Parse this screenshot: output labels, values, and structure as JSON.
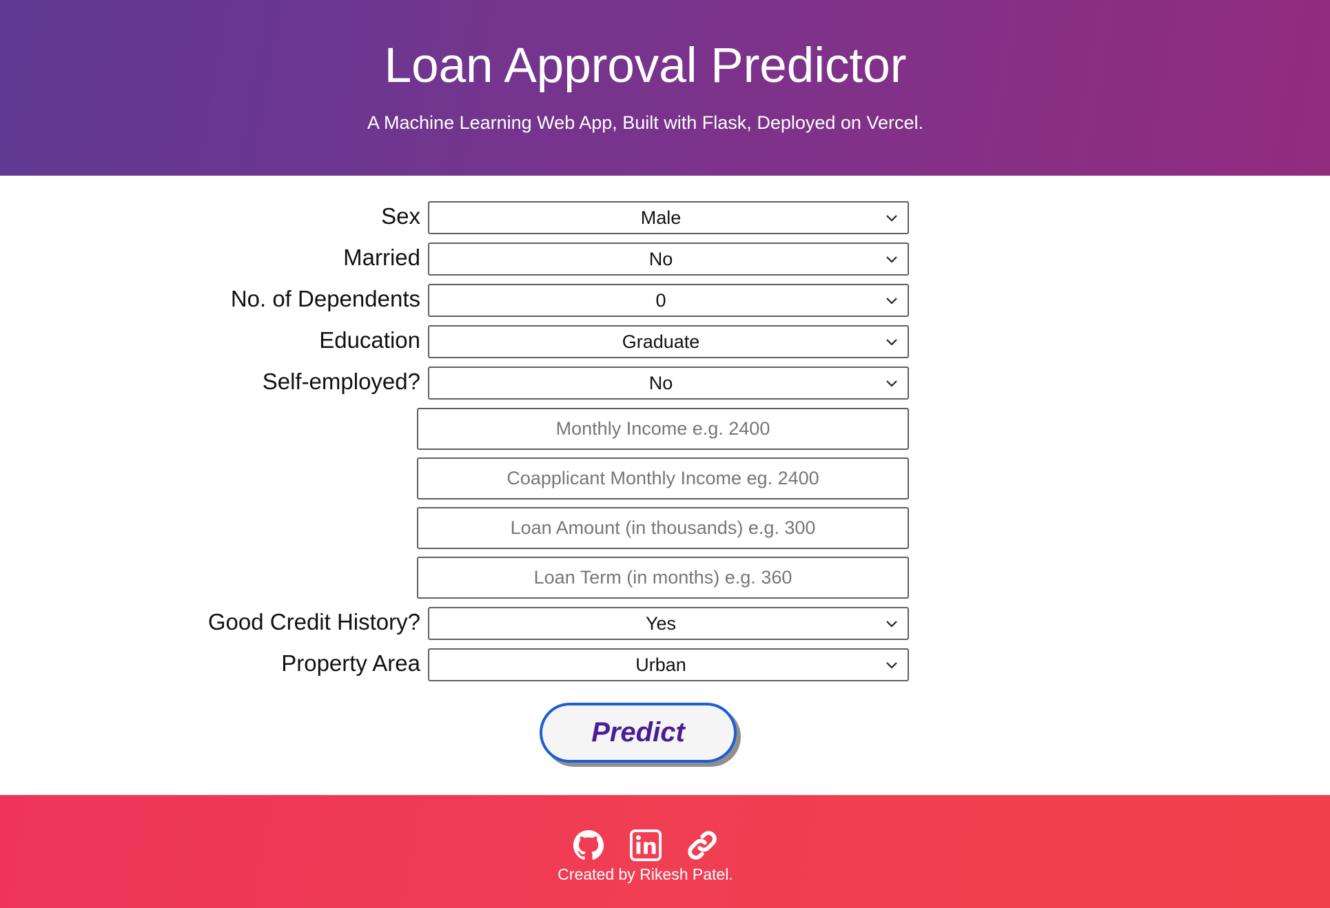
{
  "header": {
    "title": "Loan Approval Predictor",
    "subtitle": "A Machine Learning Web App, Built with Flask, Deployed on Vercel."
  },
  "form": {
    "sex": {
      "label": "Sex",
      "value": "Male"
    },
    "married": {
      "label": "Married",
      "value": "No"
    },
    "dependents": {
      "label": "No. of Dependents",
      "value": "0"
    },
    "education": {
      "label": "Education",
      "value": "Graduate"
    },
    "self_employed": {
      "label": "Self-employed?",
      "value": "No"
    },
    "monthly_income": {
      "placeholder": "Monthly Income e.g. 2400",
      "value": ""
    },
    "coapplicant_income": {
      "placeholder": "Coapplicant Monthly Income eg. 2400",
      "value": ""
    },
    "loan_amount": {
      "placeholder": "Loan Amount (in thousands) e.g. 300",
      "value": ""
    },
    "loan_term": {
      "placeholder": "Loan Term (in months) e.g. 360",
      "value": ""
    },
    "credit_history": {
      "label": "Good Credit History?",
      "value": "Yes"
    },
    "property_area": {
      "label": "Property Area",
      "value": "Urban"
    },
    "submit_label": "Predict"
  },
  "footer": {
    "icons": [
      "github-icon",
      "linkedin-icon",
      "link-icon"
    ],
    "credit": "Created by Rikesh Patel."
  },
  "colors": {
    "header_gradient_start": "#603a93",
    "header_gradient_end": "#922c7f",
    "footer_color": "#f03e52",
    "button_border": "#1a5fd1",
    "button_text": "#4a1d96"
  }
}
